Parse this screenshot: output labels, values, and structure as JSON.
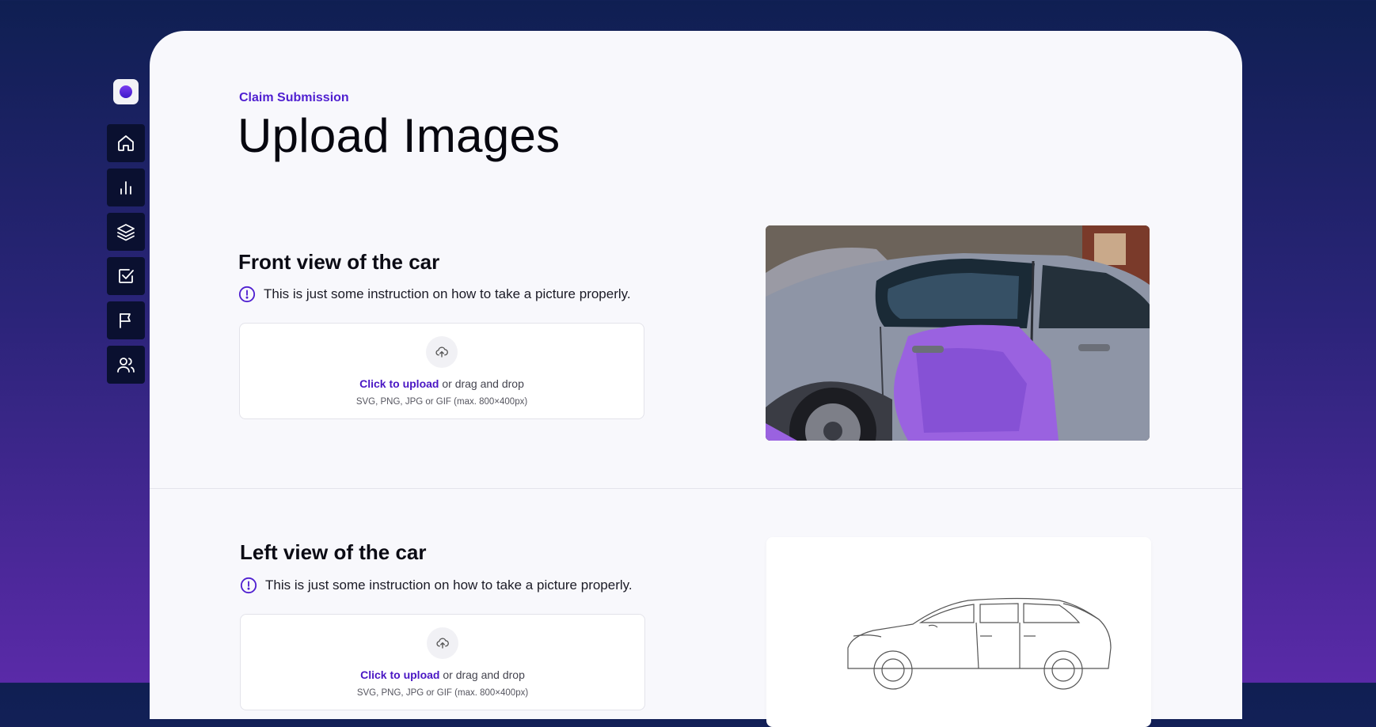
{
  "brand": {
    "logo_icon": "app-logo-icon",
    "accent": "#4f1fd0"
  },
  "sidebar": {
    "items": [
      {
        "name": "home",
        "icon": "home-icon"
      },
      {
        "name": "analytics",
        "icon": "bar-chart-icon"
      },
      {
        "name": "layers",
        "icon": "layers-icon"
      },
      {
        "name": "tasks",
        "icon": "checkbox-icon"
      },
      {
        "name": "reports",
        "icon": "flag-icon"
      },
      {
        "name": "users",
        "icon": "users-icon"
      }
    ]
  },
  "header": {
    "eyebrow": "Claim Submission",
    "title": "Upload Images"
  },
  "sections": [
    {
      "title": "Front view of the car",
      "instruction": "This is just some instruction on how to take a picture properly.",
      "upload": {
        "link_label": "Click to upload",
        "rest_label": " or drag and drop",
        "formats": "SVG, PNG, JPG or GIF (max. 800×400px)"
      },
      "preview": "damaged-car-photo"
    },
    {
      "title": "Left view of the car",
      "instruction": "This is just some instruction on how to take a picture properly.",
      "upload": {
        "link_label": "Click to upload",
        "rest_label": " or drag and drop",
        "formats": "SVG, PNG, JPG or GIF (max. 800×400px)"
      },
      "preview": "car-side-sketch"
    }
  ]
}
